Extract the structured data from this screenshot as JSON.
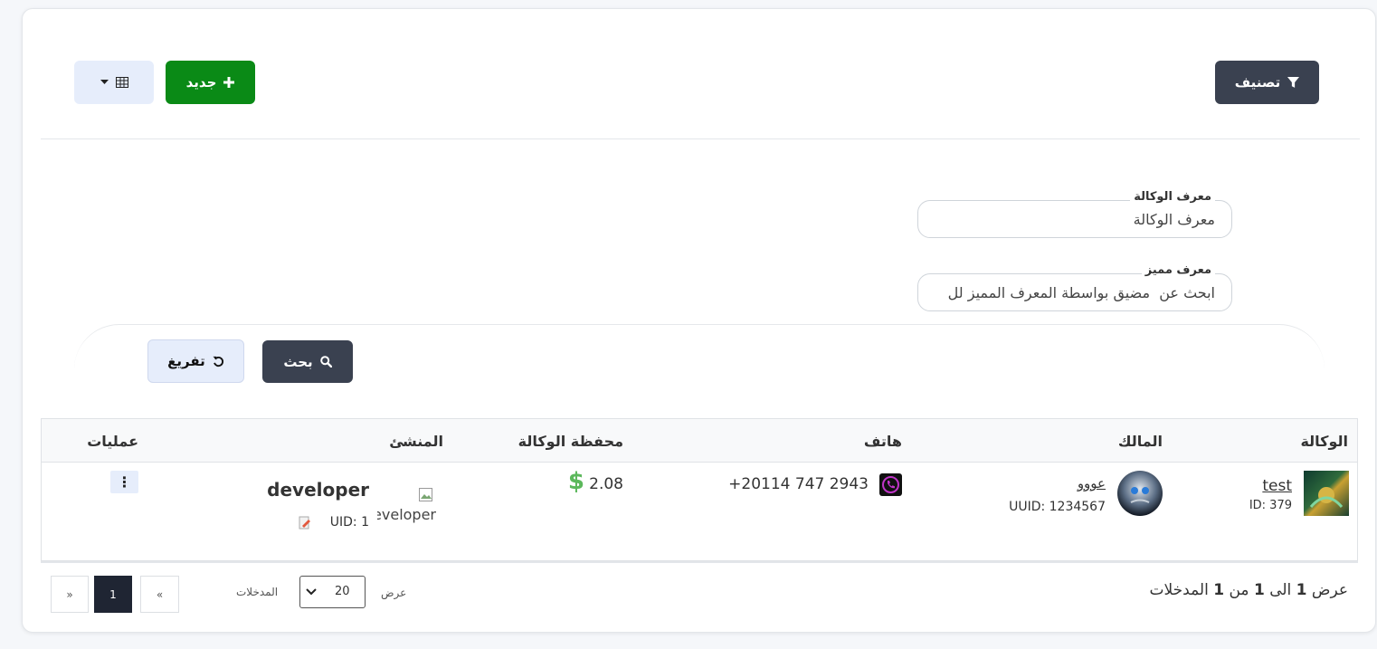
{
  "toolbar": {
    "classify_label": "تصنيف",
    "new_label": "جديد",
    "columns_icon": "table-icon"
  },
  "filters": {
    "agency_id": {
      "label": "معرف الوكالة",
      "placeholder": "معرف الوكالة"
    },
    "unique_id": {
      "label": "معرف مميز",
      "value": "ابحث عن  مضيق بواسطة المعرف المميز لل"
    }
  },
  "actions": {
    "search_label": "بحث",
    "reset_label": "تفريغ"
  },
  "table": {
    "headers": {
      "agency": "الوكالة",
      "owner": "المالك",
      "phone": "هاتف",
      "wallet": "محفظة الوكالة",
      "creator": "المنشئ",
      "operations": "عمليات"
    },
    "rows": [
      {
        "agency_name": "test",
        "agency_id": "ID: 379",
        "owner_name": "عووو",
        "owner_uuid": "UUID: 1234567",
        "phone": "+20114 747 2943",
        "wallet": "2.08",
        "wallet_currency": "$",
        "creator_name": "developer",
        "creator_img_alt": "developer",
        "creator_uid": "UID: 1",
        "menu_icon": "⋮"
      }
    ]
  },
  "footer": {
    "summary": {
      "prefix": "عرض",
      "from": "1",
      "to_word": "الى",
      "to": "1",
      "of_word": "من",
      "total": "1",
      "suffix": "المدخلات"
    },
    "show_label": "عرض",
    "entries_label": "المدخلات",
    "page_size": "20",
    "pagination": {
      "prev": "«",
      "current": "1",
      "next": "»"
    }
  },
  "colors": {
    "primary_dark": "#3a4150",
    "success": "#0a8a16",
    "dollar": "#5cb85c",
    "phone_icon": "#c035c8"
  }
}
